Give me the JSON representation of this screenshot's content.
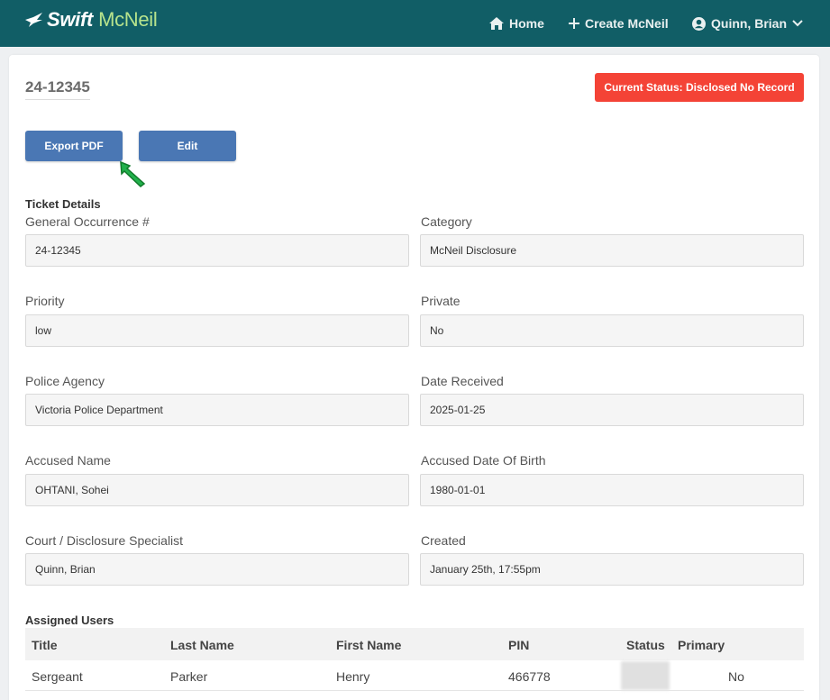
{
  "nav": {
    "brand_swift": "Swift",
    "brand_mcneil": "McNeil",
    "home": "Home",
    "create": "Create McNeil",
    "user": "Quinn, Brian"
  },
  "ticket": {
    "id": "24-12345",
    "status": "Current Status: Disclosed No Record",
    "export_label": "Export PDF",
    "edit_label": "Edit"
  },
  "details": {
    "title": "Ticket Details",
    "general_occurrence_label": "General Occurrence #",
    "general_occurrence": "24-12345",
    "category_label": "Category",
    "category": "McNeil Disclosure",
    "priority_label": "Priority",
    "priority": "low",
    "private_label": "Private",
    "private": "No",
    "agency_label": "Police Agency",
    "agency": "Victoria Police Department",
    "date_received_label": "Date Received",
    "date_received": "2025-01-25",
    "accused_name_label": "Accused Name",
    "accused_name": "OHTANI, Sohei",
    "accused_dob_label": "Accused Date Of Birth",
    "accused_dob": "1980-01-01",
    "specialist_label": "Court / Disclosure Specialist",
    "specialist": "Quinn, Brian",
    "created_label": "Created",
    "created": "January 25th, 17:55pm"
  },
  "assigned": {
    "title": "Assigned Users",
    "columns": [
      "Title",
      "Last Name",
      "First Name",
      "PIN",
      "Status",
      "Primary"
    ],
    "rows": [
      [
        "Sergeant",
        "Parker",
        "Henry",
        "466778",
        "",
        "No"
      ]
    ]
  },
  "colors": {
    "navbar": "#115e66",
    "button": "#4a77b4",
    "status": "#f44336"
  }
}
